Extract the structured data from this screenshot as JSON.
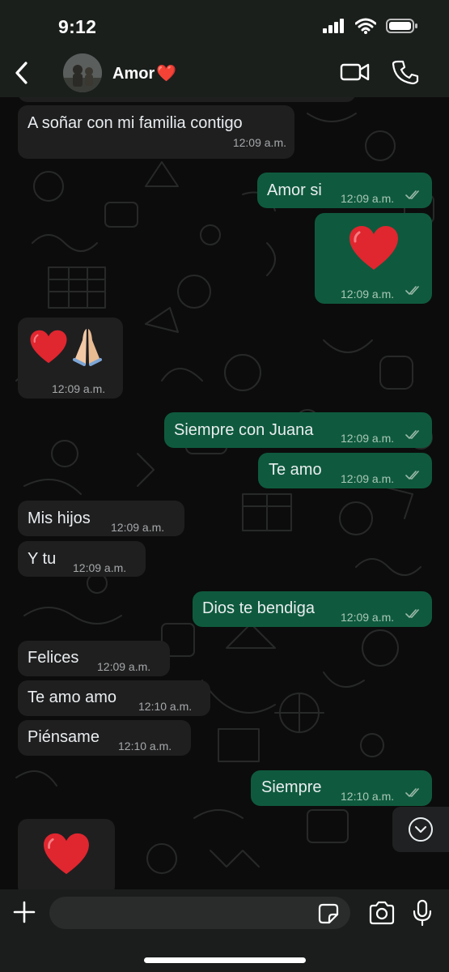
{
  "status_bar": {
    "time": "9:12"
  },
  "header": {
    "contact_name": "Amor",
    "contact_emoji": "❤️"
  },
  "messages": [
    {
      "dir": "in",
      "text": "A soñar con mi familia contigo",
      "time": "12:09 a.m."
    },
    {
      "dir": "out",
      "text": "Amor si",
      "time": "12:09 a.m."
    },
    {
      "dir": "out",
      "emoji": "❤️",
      "time": "12:09 a.m."
    },
    {
      "dir": "in",
      "emoji": "❤️🙏🏻",
      "time": "12:09 a.m."
    },
    {
      "dir": "out",
      "text": "Siempre con Juana",
      "time": "12:09 a.m."
    },
    {
      "dir": "out",
      "text": "Te amo",
      "time": "12:09 a.m."
    },
    {
      "dir": "in",
      "text": "Mis hijos",
      "time": "12:09 a.m."
    },
    {
      "dir": "in",
      "text": "Y tu",
      "time": "12:09 a.m."
    },
    {
      "dir": "out",
      "text": "Dios te bendiga",
      "time": "12:09 a.m."
    },
    {
      "dir": "in",
      "text": "Felices",
      "time": "12:09 a.m."
    },
    {
      "dir": "in",
      "text": "Te amo amo",
      "time": "12:10 a.m."
    },
    {
      "dir": "in",
      "text": "Piénsame",
      "time": "12:10 a.m."
    },
    {
      "dir": "out",
      "text": "Siempre",
      "time": "12:10 a.m."
    },
    {
      "dir": "in",
      "emoji": "❤️"
    }
  ],
  "composer": {
    "input_value": "",
    "input_placeholder": ""
  },
  "icons": {
    "back": "chevron-left-icon",
    "video_call": "video-camera-icon",
    "voice_call": "phone-icon",
    "scroll_down": "chevron-down-icon",
    "attach": "plus-icon",
    "sticker": "sticker-icon",
    "camera": "camera-icon",
    "microphone": "microphone-icon"
  },
  "colors": {
    "incoming_bubble": "#1f1f20",
    "outgoing_bubble": "#0f5a3e",
    "header_bg": "#1a1f1c",
    "heart": "#e0262f"
  }
}
